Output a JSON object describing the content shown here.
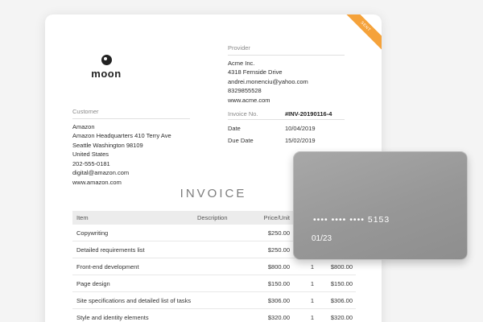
{
  "badge": "SENT",
  "logo": {
    "name": "moon"
  },
  "provider": {
    "heading": "Provider",
    "lines": [
      "Acme Inc.",
      "4318 Fernside Drive",
      "andrei.monenciu@yahoo.com",
      "8329855528",
      "www.acme.com"
    ]
  },
  "customer": {
    "heading": "Customer",
    "lines": [
      "Amazon",
      "Amazon Headquarters 410 Terry Ave",
      "Seattle Washington 98109",
      "United States",
      "202-555-0181",
      "digital@amazon.com",
      "www.amazon.com"
    ]
  },
  "meta": {
    "invoice_no_label": "Invoice No.",
    "invoice_no": "#INV-20190116-4",
    "date_label": "Date",
    "date": "10/04/2019",
    "due_label": "Due Date",
    "due": "15/02/2019"
  },
  "title": "INVOICE",
  "table": {
    "headers": {
      "item": "Item",
      "description": "Description",
      "price": "Price/Unit",
      "qty": "",
      "total": ""
    },
    "rows": [
      {
        "item": "Copywriting",
        "description": "",
        "price": "$250.00",
        "qty": "",
        "total": ""
      },
      {
        "item": "Detailed requirements list",
        "description": "",
        "price": "$250.00",
        "qty": "",
        "total": ""
      },
      {
        "item": "Front-end development",
        "description": "",
        "price": "$800.00",
        "qty": "1",
        "total": "$800.00"
      },
      {
        "item": "Page design",
        "description": "",
        "price": "$150.00",
        "qty": "1",
        "total": "$150.00"
      },
      {
        "item": "Site specifications and detailed list of tasks",
        "description": "",
        "price": "$306.00",
        "qty": "1",
        "total": "$306.00"
      },
      {
        "item": "Style and identity elements",
        "description": "",
        "price": "$320.00",
        "qty": "1",
        "total": "$320.00"
      }
    ]
  },
  "card": {
    "number": "•••• •••• •••• 5153",
    "expiry": "01/23"
  }
}
